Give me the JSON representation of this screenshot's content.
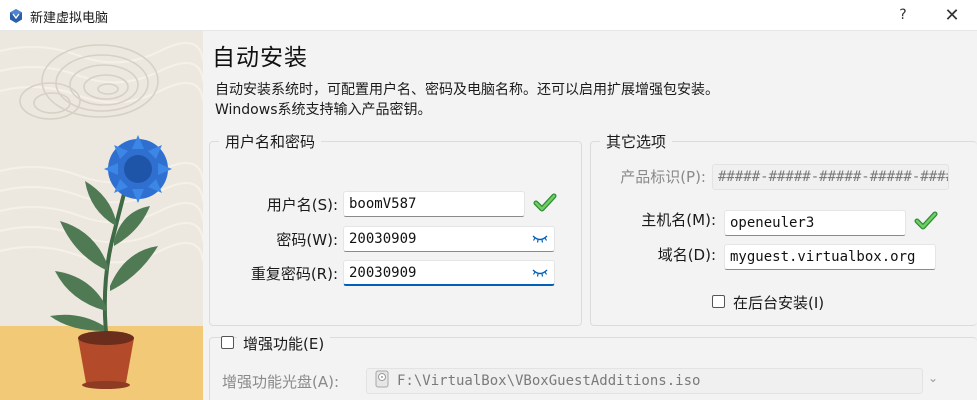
{
  "window": {
    "title": "新建虚拟电脑",
    "help_label": "?",
    "close_label": "✕"
  },
  "main": {
    "heading": "自动安装",
    "description_line1": "自动安装系统时，可配置用户名、密码及电脑名称。还可以启用扩展增强包安装。",
    "description_line2": "Windows系统支持输入产品密钥。"
  },
  "user_group": {
    "legend": "用户名和密码",
    "username_label": "用户名(S):",
    "username_value": "boomV587",
    "password_label": "密码(W):",
    "password_value": "20030909",
    "repeat_label": "重复密码(R):",
    "repeat_value": "20030909"
  },
  "other_group": {
    "legend": "其它选项",
    "product_key_label": "产品标识(P):",
    "product_key_value": "#####-#####-#####-#####-#####",
    "hostname_label": "主机名(M):",
    "hostname_value": "openeuler3",
    "domain_label": "域名(D):",
    "domain_value": "myguest.virtualbox.org",
    "background_install_label": "在后台安装(I)",
    "background_install_checked": false
  },
  "additions_group": {
    "legend": "增强功能(E)",
    "checked": false,
    "iso_label": "增强功能光盘(A):",
    "iso_value": "F:\\VirtualBox\\VBoxGuestAdditions.iso"
  },
  "colors": {
    "accent": "#005fb8",
    "valid_check": "#3cb44a",
    "disabled_text": "#8a8a8a",
    "panel_background": "#f3f3f3"
  },
  "icons": {
    "app": "virtualbox-icon",
    "valid": "check-icon",
    "reveal": "eye-closed-icon",
    "iso": "disc-icon"
  }
}
